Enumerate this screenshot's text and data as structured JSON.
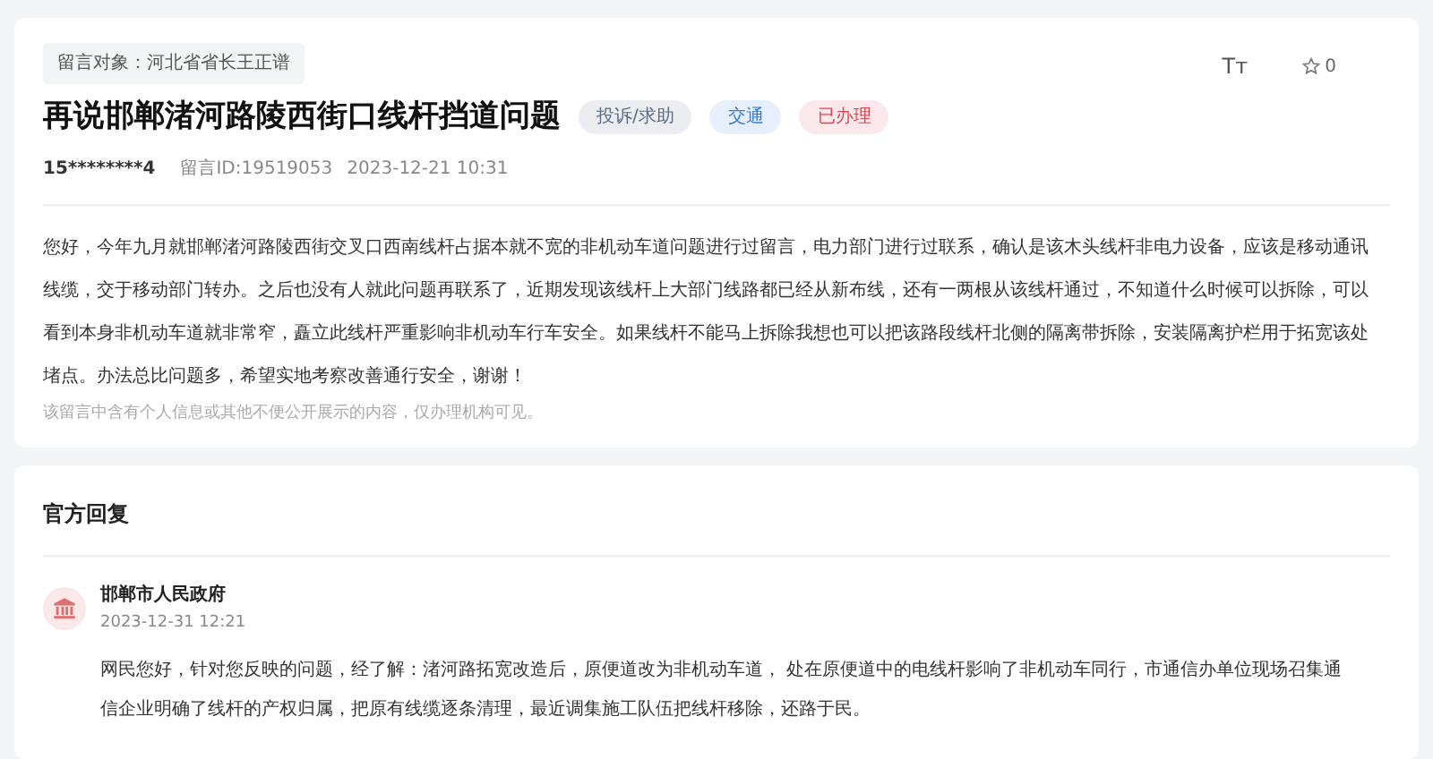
{
  "message": {
    "target": "留言对象：河北省省长王正谱",
    "title": "再说邯郸渚河路陵西街口线杆挡道问题",
    "tags": [
      {
        "label": "投诉/求助",
        "color": "#5a6b85"
      },
      {
        "label": "交通",
        "color": "#2f7be0"
      },
      {
        "label": "已办理",
        "color": "#e0454f"
      }
    ],
    "author": "15********4",
    "message_id": "留言ID:19519053",
    "time": "2023-12-21 10:31",
    "font_button": "Tт",
    "favorites": "0",
    "body": "您好，今年九月就邯郸渚河路陵西街交叉口西南线杆占据本就不宽的非机动车道问题进行过留言，电力部门进行过联系，确认是该木头线杆非电力设备，应该是移动通讯线缆，交于移动部门转办。之后也没有人就此问题再联系了，近期发现该线杆上大部门线路都已经从新布线，还有一两根从该线杆通过，不知道什么时候可以拆除，可以看到本身非机动车道就非常窄，矗立此线杆严重影响非机动车行车安全。如果线杆不能马上拆除我想也可以把该路段线杆北侧的隔离带拆除，安装隔离护栏用于拓宽该处堵点。办法总比问题多，希望实地考察改善通行安全，谢谢！",
    "privacy_note": "该留言中含有个人信息或其他不便公开展示的内容，仅办理机构可见。"
  },
  "reply": {
    "heading": "官方回复",
    "department": "邯郸市人民政府",
    "time": "2023-12-31 12:21",
    "body": "网民您好，针对您反映的问题，经了解：渚河路拓宽改造后，原便道改为非机动车道， 处在原便道中的电线杆影响了非机动车同行，市通信办单位现场召集通信企业明确了线杆的产权归属，把原有线缆逐条清理，最近调集施工队伍把线杆移除，还路于民。"
  }
}
